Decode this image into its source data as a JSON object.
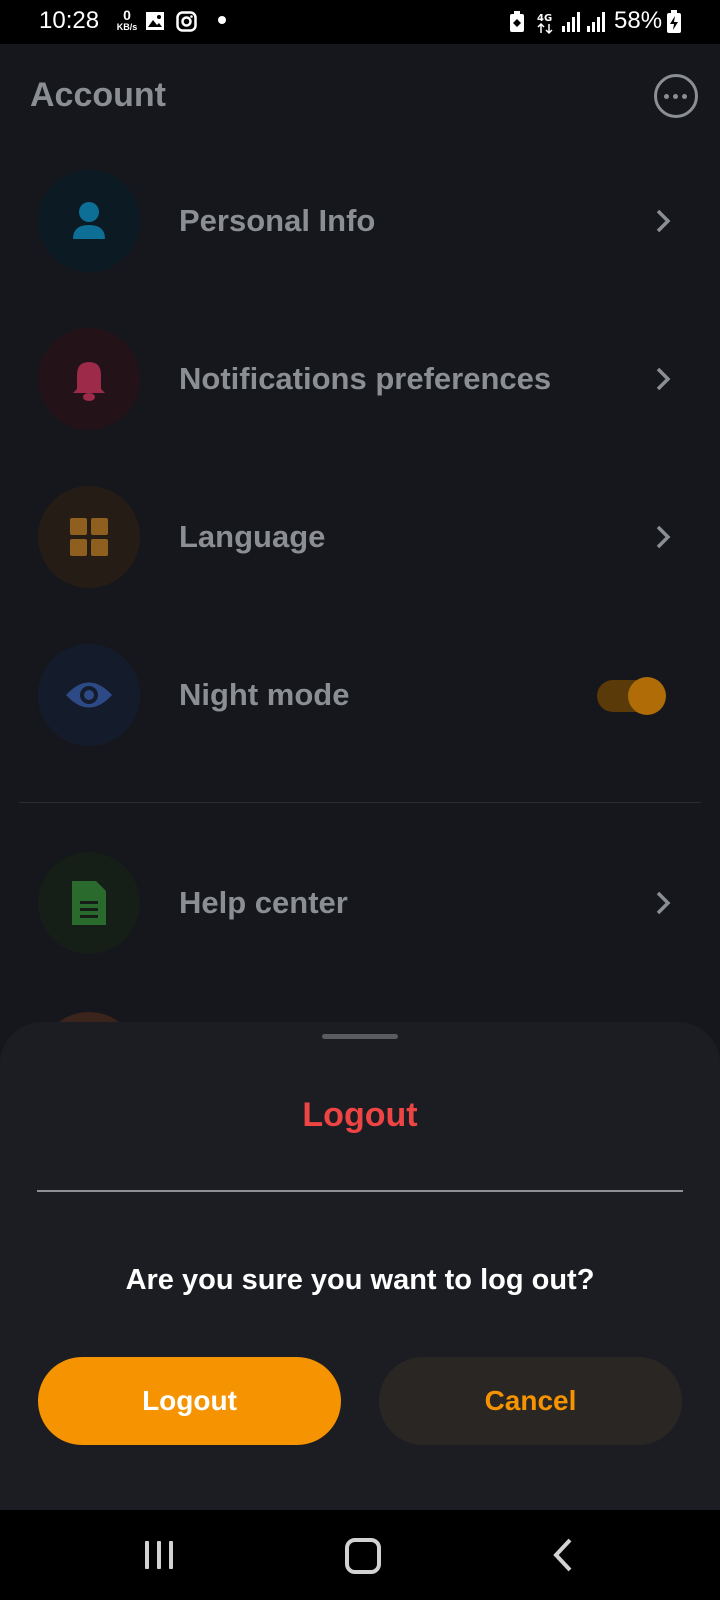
{
  "status_bar": {
    "time": "10:28",
    "net_speed_value": "0",
    "net_speed_unit": "KB/s",
    "network": "4G",
    "battery": "58%"
  },
  "page": {
    "title": "Account",
    "menu_items": [
      {
        "label": "Personal Info",
        "icon": "person-icon",
        "icon_color": "#0e6f96"
      },
      {
        "label": "Notifications preferences",
        "icon": "bell-icon",
        "icon_color": "#9c2a48"
      },
      {
        "label": "Language",
        "icon": "grid-icon",
        "icon_color": "#8f5f1f"
      },
      {
        "label": "Night mode",
        "icon": "eye-icon",
        "icon_color": "#2d4a86",
        "toggle_on": true
      },
      {
        "label": "Help center",
        "icon": "document-icon",
        "icon_color": "#2a6a2d"
      }
    ]
  },
  "sheet": {
    "title": "Logout",
    "message": "Are you sure you want to log out?",
    "confirm_label": "Logout",
    "cancel_label": "Cancel"
  },
  "colors": {
    "accent": "#f59300",
    "danger": "#ef4444",
    "sheet_bg": "#1c1d22"
  }
}
